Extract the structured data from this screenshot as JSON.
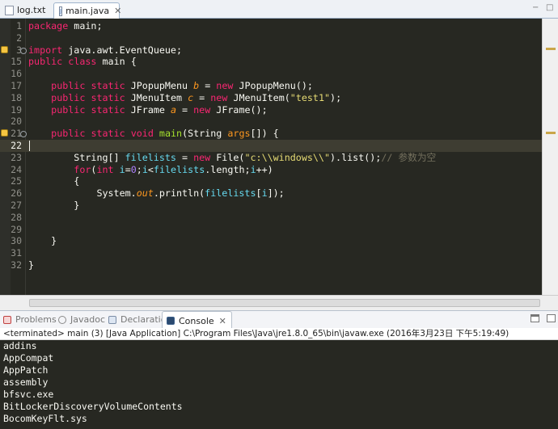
{
  "editor_tabs": [
    {
      "label": "log.txt",
      "active": false
    },
    {
      "label": "main.java",
      "active": true,
      "close": "✕"
    }
  ],
  "tab_bar_buttons": {
    "minimize": "−",
    "maximize": "□"
  },
  "code_lines": [
    {
      "n": "1",
      "text": "package main;"
    },
    {
      "n": "2",
      "text": ""
    },
    {
      "n": "3",
      "text": "import java.awt.EventQueue;",
      "warning": true,
      "fold": true
    },
    {
      "n": "15",
      "text": "public class main {"
    },
    {
      "n": "16",
      "text": ""
    },
    {
      "n": "17",
      "text": "    public static JPopupMenu b = new JPopupMenu();"
    },
    {
      "n": "18",
      "text": "    public static JMenuItem c = new JMenuItem(\"test1\");"
    },
    {
      "n": "19",
      "text": "    public static JFrame a = new JFrame();"
    },
    {
      "n": "20",
      "text": ""
    },
    {
      "n": "21",
      "text": "    public static void main(String args[]) {",
      "warning": true,
      "fold": true
    },
    {
      "n": "22",
      "text": "",
      "current": true
    },
    {
      "n": "23",
      "text": "        String[] filelists = new File(\"c:\\\\windows\\\\\").list();// 参数为空"
    },
    {
      "n": "24",
      "text": "        for(int i=0;i<filelists.length;i++)"
    },
    {
      "n": "25",
      "text": "        {"
    },
    {
      "n": "26",
      "text": "            System.out.println(filelists[i]);"
    },
    {
      "n": "27",
      "text": "        }"
    },
    {
      "n": "28",
      "text": ""
    },
    {
      "n": "29",
      "text": ""
    },
    {
      "n": "30",
      "text": "    }"
    },
    {
      "n": "31",
      "text": ""
    },
    {
      "n": "32",
      "text": "}"
    }
  ],
  "view_tabs": [
    {
      "label": "Problems",
      "icon": "problems-icon"
    },
    {
      "label": "Javadoc",
      "icon": "javadoc-icon"
    },
    {
      "label": "Declaration",
      "icon": "declaration-icon"
    },
    {
      "label": "Console",
      "icon": "console-icon",
      "active": true,
      "close": "✕"
    }
  ],
  "console": {
    "status": "<terminated> main (3) [Java Application] C:\\Program Files\\Java\\jre1.8.0_65\\bin\\javaw.exe (2016年3月23日 下午5:19:49)",
    "output": [
      "addins",
      "AppCompat",
      "AppPatch",
      "assembly",
      "bfsvc.exe",
      "BitLockerDiscoveryVolumeContents",
      "BocomKeyFlt.sys"
    ]
  },
  "colors": {
    "editor_bg": "#272822",
    "keyword": "#f92672",
    "type": "#66d9ef",
    "string": "#e6db74",
    "method": "#a6e22e",
    "static_field": "#fd971f"
  }
}
